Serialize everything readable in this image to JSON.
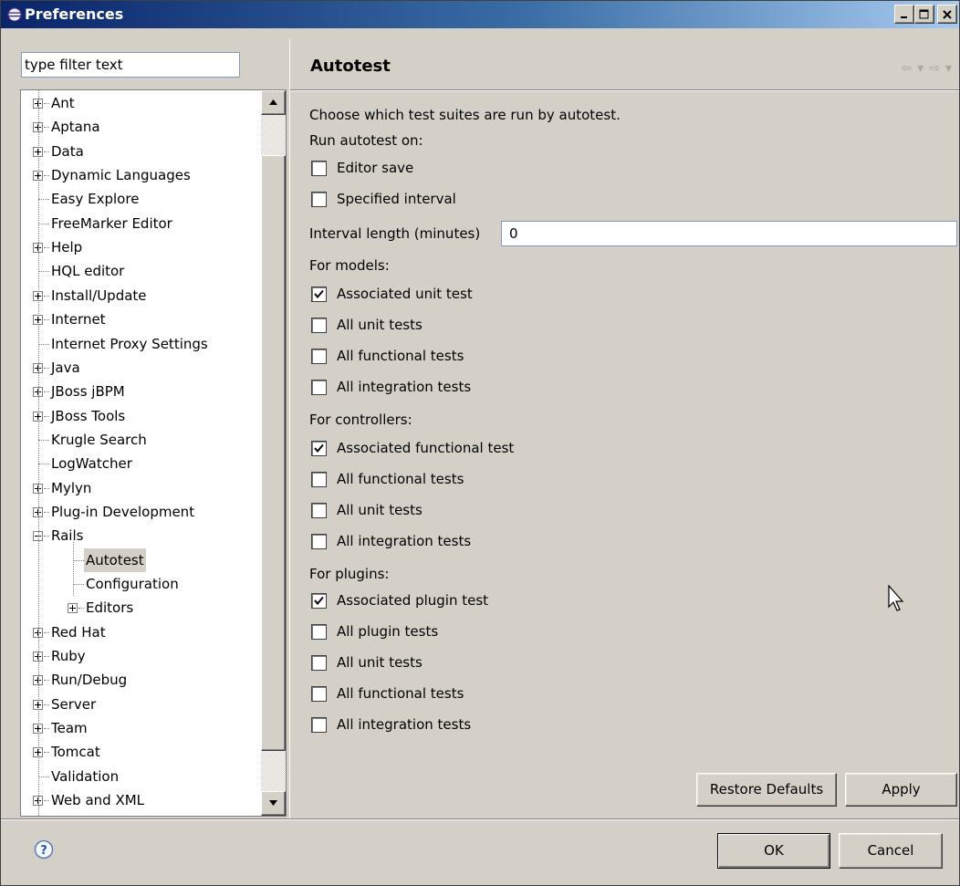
{
  "window": {
    "title": "Preferences"
  },
  "filter": {
    "value": "type filter text"
  },
  "tree": [
    {
      "label": "Ant",
      "expander": "plus"
    },
    {
      "label": "Aptana",
      "expander": "plus"
    },
    {
      "label": "Data",
      "expander": "plus"
    },
    {
      "label": "Dynamic Languages",
      "expander": "plus"
    },
    {
      "label": "Easy Explore",
      "expander": "none"
    },
    {
      "label": "FreeMarker Editor",
      "expander": "none"
    },
    {
      "label": "Help",
      "expander": "plus"
    },
    {
      "label": "HQL editor",
      "expander": "none"
    },
    {
      "label": "Install/Update",
      "expander": "plus"
    },
    {
      "label": "Internet",
      "expander": "plus"
    },
    {
      "label": "Internet Proxy Settings",
      "expander": "none"
    },
    {
      "label": "Java",
      "expander": "plus"
    },
    {
      "label": "JBoss jBPM",
      "expander": "plus"
    },
    {
      "label": "JBoss Tools",
      "expander": "plus"
    },
    {
      "label": "Krugle Search",
      "expander": "none"
    },
    {
      "label": "LogWatcher",
      "expander": "none"
    },
    {
      "label": "Mylyn",
      "expander": "plus"
    },
    {
      "label": "Plug-in Development",
      "expander": "plus"
    },
    {
      "label": "Rails",
      "expander": "minus"
    },
    {
      "label": "Autotest",
      "expander": "none",
      "level": 1,
      "selected": true
    },
    {
      "label": "Configuration",
      "expander": "none",
      "level": 1
    },
    {
      "label": "Editors",
      "expander": "plus",
      "level": 1
    },
    {
      "label": "Red Hat",
      "expander": "plus"
    },
    {
      "label": "Ruby",
      "expander": "plus"
    },
    {
      "label": "Run/Debug",
      "expander": "plus"
    },
    {
      "label": "Server",
      "expander": "plus"
    },
    {
      "label": "Team",
      "expander": "plus"
    },
    {
      "label": "Tomcat",
      "expander": "plus"
    },
    {
      "label": "Validation",
      "expander": "none"
    },
    {
      "label": "Web and XML",
      "expander": "plus"
    }
  ],
  "page": {
    "title": "Autotest",
    "description": "Choose which test suites are run by autotest.",
    "run_on_label": "Run autotest on:",
    "run_on": [
      {
        "label": "Editor save",
        "checked": false
      },
      {
        "label": "Specified interval",
        "checked": false
      }
    ],
    "interval_label": "Interval length (minutes)",
    "interval_value": "0",
    "models_label": "For models:",
    "models": [
      {
        "label": "Associated unit test",
        "checked": true
      },
      {
        "label": "All unit tests",
        "checked": false
      },
      {
        "label": "All functional tests",
        "checked": false
      },
      {
        "label": "All integration tests",
        "checked": false
      }
    ],
    "controllers_label": "For controllers:",
    "controllers": [
      {
        "label": "Associated functional test",
        "checked": true
      },
      {
        "label": "All functional tests",
        "checked": false
      },
      {
        "label": "All unit tests",
        "checked": false
      },
      {
        "label": "All integration tests",
        "checked": false
      }
    ],
    "plugins_label": "For plugins:",
    "plugins": [
      {
        "label": "Associated plugin test",
        "checked": true
      },
      {
        "label": "All plugin tests",
        "checked": false
      },
      {
        "label": "All unit tests",
        "checked": false
      },
      {
        "label": "All functional tests",
        "checked": false
      },
      {
        "label": "All integration tests",
        "checked": false
      }
    ],
    "restore_label": "Restore Defaults",
    "apply_label": "Apply"
  },
  "dialog": {
    "ok_label": "OK",
    "cancel_label": "Cancel"
  },
  "icons": {
    "app": "eclipse-icon",
    "help": "help-icon",
    "back": "back-arrow-icon",
    "forward": "forward-arrow-icon"
  }
}
